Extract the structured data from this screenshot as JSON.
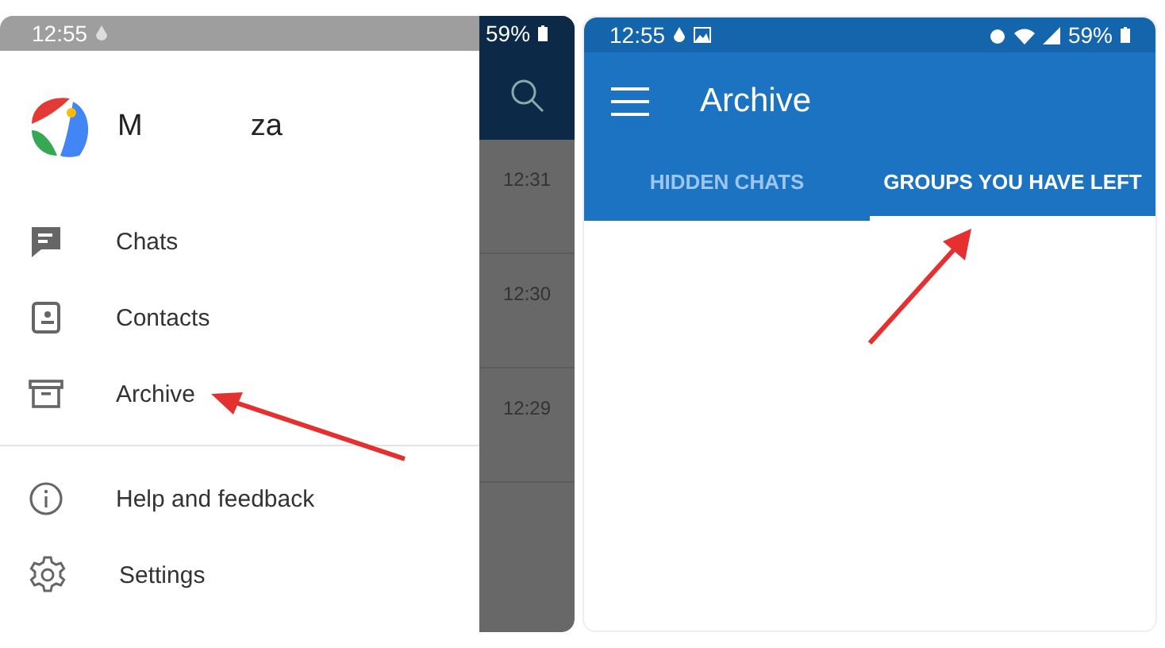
{
  "left_screen": {
    "status_bar": {
      "time": "12:55",
      "battery": "59%"
    },
    "profile": {
      "name_start": "M",
      "name_end": "za"
    },
    "menu_sections": [
      [
        {
          "kind": "chat",
          "label": "Chats"
        },
        {
          "kind": "contacts",
          "label": "Contacts"
        },
        {
          "kind": "archive",
          "label": "Archive"
        }
      ],
      [
        {
          "kind": "info",
          "label": "Help and feedback"
        },
        {
          "kind": "settings",
          "label": "Settings"
        }
      ]
    ],
    "chat_times": [
      "12:31",
      "12:30",
      "12:29"
    ]
  },
  "right_screen": {
    "status_bar": {
      "time": "12:55",
      "battery": "59%"
    },
    "title": "Archive",
    "tabs": [
      {
        "label": "HIDDEN CHATS",
        "selected": false
      },
      {
        "label": "GROUPS YOU HAVE LEFT",
        "selected": true
      }
    ]
  }
}
